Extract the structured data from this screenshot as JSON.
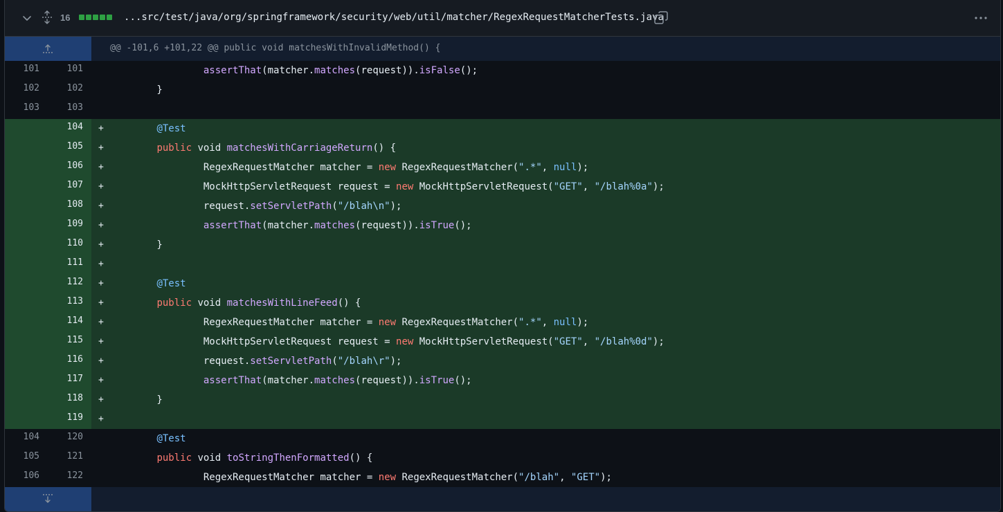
{
  "file": {
    "change_count": "16",
    "path": "...src/test/java/org/springframework/security/web/util/matcher/RegexRequestMatcherTests.java",
    "colors": {
      "added": "#2ea043",
      "added_bg": "#1b3a28",
      "hunk_bg": "#1f3f73"
    }
  },
  "hunk": {
    "header": "@@ -101,6 +101,22 @@ public void matchesWithInvalidMethod() {"
  },
  "lines": [
    {
      "type": "ctx",
      "old": "101",
      "new": "101",
      "tokens": [
        {
          "t": "\t\t"
        },
        {
          "t": "assertThat",
          "c": "f"
        },
        {
          "t": "(matcher."
        },
        {
          "t": "matches",
          "c": "f"
        },
        {
          "t": "(request))."
        },
        {
          "t": "isFalse",
          "c": "f"
        },
        {
          "t": "();"
        }
      ]
    },
    {
      "type": "ctx",
      "old": "102",
      "new": "102",
      "tokens": [
        {
          "t": "\t}"
        }
      ]
    },
    {
      "type": "ctx",
      "old": "103",
      "new": "103",
      "tokens": []
    },
    {
      "type": "add",
      "old": "",
      "new": "104",
      "tokens": [
        {
          "t": "\t"
        },
        {
          "t": "@Test",
          "c": "a"
        }
      ]
    },
    {
      "type": "add",
      "old": "",
      "new": "105",
      "tokens": [
        {
          "t": "\t"
        },
        {
          "t": "public",
          "c": "k"
        },
        {
          "t": " void "
        },
        {
          "t": "matchesWithCarriageReturn",
          "c": "f"
        },
        {
          "t": "() {"
        }
      ]
    },
    {
      "type": "add",
      "old": "",
      "new": "106",
      "tokens": [
        {
          "t": "\t\tRegexRequestMatcher matcher = "
        },
        {
          "t": "new",
          "c": "k"
        },
        {
          "t": " RegexRequestMatcher("
        },
        {
          "t": "\".*\"",
          "c": "s"
        },
        {
          "t": ", "
        },
        {
          "t": "null",
          "c": "a"
        },
        {
          "t": ");"
        }
      ]
    },
    {
      "type": "add",
      "old": "",
      "new": "107",
      "tokens": [
        {
          "t": "\t\tMockHttpServletRequest request = "
        },
        {
          "t": "new",
          "c": "k"
        },
        {
          "t": " MockHttpServletRequest("
        },
        {
          "t": "\"GET\"",
          "c": "s"
        },
        {
          "t": ", "
        },
        {
          "t": "\"/blah%0a\"",
          "c": "s"
        },
        {
          "t": ");"
        }
      ]
    },
    {
      "type": "add",
      "old": "",
      "new": "108",
      "tokens": [
        {
          "t": "\t\trequest."
        },
        {
          "t": "setServletPath",
          "c": "f"
        },
        {
          "t": "("
        },
        {
          "t": "\"/blah\\n\"",
          "c": "s"
        },
        {
          "t": ");"
        }
      ]
    },
    {
      "type": "add",
      "old": "",
      "new": "109",
      "tokens": [
        {
          "t": "\t\t"
        },
        {
          "t": "assertThat",
          "c": "f"
        },
        {
          "t": "(matcher."
        },
        {
          "t": "matches",
          "c": "f"
        },
        {
          "t": "(request))."
        },
        {
          "t": "isTrue",
          "c": "f"
        },
        {
          "t": "();"
        }
      ]
    },
    {
      "type": "add",
      "old": "",
      "new": "110",
      "tokens": [
        {
          "t": "\t}"
        }
      ]
    },
    {
      "type": "add",
      "old": "",
      "new": "111",
      "tokens": []
    },
    {
      "type": "add",
      "old": "",
      "new": "112",
      "tokens": [
        {
          "t": "\t"
        },
        {
          "t": "@Test",
          "c": "a"
        }
      ]
    },
    {
      "type": "add",
      "old": "",
      "new": "113",
      "tokens": [
        {
          "t": "\t"
        },
        {
          "t": "public",
          "c": "k"
        },
        {
          "t": " void "
        },
        {
          "t": "matchesWithLineFeed",
          "c": "f"
        },
        {
          "t": "() {"
        }
      ]
    },
    {
      "type": "add",
      "old": "",
      "new": "114",
      "tokens": [
        {
          "t": "\t\tRegexRequestMatcher matcher = "
        },
        {
          "t": "new",
          "c": "k"
        },
        {
          "t": " RegexRequestMatcher("
        },
        {
          "t": "\".*\"",
          "c": "s"
        },
        {
          "t": ", "
        },
        {
          "t": "null",
          "c": "a"
        },
        {
          "t": ");"
        }
      ]
    },
    {
      "type": "add",
      "old": "",
      "new": "115",
      "tokens": [
        {
          "t": "\t\tMockHttpServletRequest request = "
        },
        {
          "t": "new",
          "c": "k"
        },
        {
          "t": " MockHttpServletRequest("
        },
        {
          "t": "\"GET\"",
          "c": "s"
        },
        {
          "t": ", "
        },
        {
          "t": "\"/blah%0d\"",
          "c": "s"
        },
        {
          "t": ");"
        }
      ]
    },
    {
      "type": "add",
      "old": "",
      "new": "116",
      "tokens": [
        {
          "t": "\t\trequest."
        },
        {
          "t": "setServletPath",
          "c": "f"
        },
        {
          "t": "("
        },
        {
          "t": "\"/blah\\r\"",
          "c": "s"
        },
        {
          "t": ");"
        }
      ]
    },
    {
      "type": "add",
      "old": "",
      "new": "117",
      "tokens": [
        {
          "t": "\t\t"
        },
        {
          "t": "assertThat",
          "c": "f"
        },
        {
          "t": "(matcher."
        },
        {
          "t": "matches",
          "c": "f"
        },
        {
          "t": "(request))."
        },
        {
          "t": "isTrue",
          "c": "f"
        },
        {
          "t": "();"
        }
      ]
    },
    {
      "type": "add",
      "old": "",
      "new": "118",
      "tokens": [
        {
          "t": "\t}"
        }
      ]
    },
    {
      "type": "add",
      "old": "",
      "new": "119",
      "tokens": []
    },
    {
      "type": "ctx",
      "old": "104",
      "new": "120",
      "tokens": [
        {
          "t": "\t"
        },
        {
          "t": "@Test",
          "c": "a"
        }
      ]
    },
    {
      "type": "ctx",
      "old": "105",
      "new": "121",
      "tokens": [
        {
          "t": "\t"
        },
        {
          "t": "public",
          "c": "k"
        },
        {
          "t": " void "
        },
        {
          "t": "toStringThenFormatted",
          "c": "f"
        },
        {
          "t": "() {"
        }
      ]
    },
    {
      "type": "ctx",
      "old": "106",
      "new": "122",
      "tokens": [
        {
          "t": "\t\tRegexRequestMatcher matcher = "
        },
        {
          "t": "new",
          "c": "k"
        },
        {
          "t": " RegexRequestMatcher("
        },
        {
          "t": "\"/blah\"",
          "c": "s"
        },
        {
          "t": ", "
        },
        {
          "t": "\"GET\"",
          "c": "s"
        },
        {
          "t": ");"
        }
      ]
    }
  ],
  "icons": {
    "collapse": "chevron-down-icon",
    "expand_all": "unfold-icon",
    "copy": "copy-icon",
    "more": "kebab-horizontal-icon",
    "expand_up": "expand-up-icon",
    "expand_down": "expand-down-icon"
  }
}
